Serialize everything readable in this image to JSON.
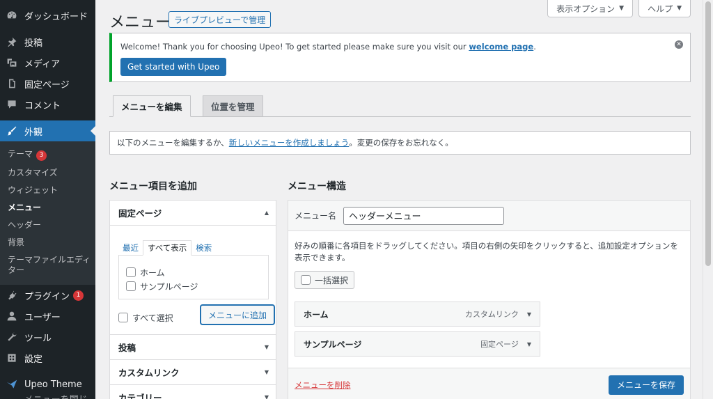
{
  "sidebar": {
    "dashboard": "ダッシュボード",
    "posts": "投稿",
    "media": "メディア",
    "pages": "固定ページ",
    "comments": "コメント",
    "appearance": "外観",
    "submenu": {
      "themes": "テーマ",
      "themes_badge": "3",
      "customize": "カスタマイズ",
      "widgets": "ウィジェット",
      "menus": "メニュー",
      "header": "ヘッダー",
      "background": "背景",
      "theme_editor": "テーマファイルエディター"
    },
    "plugins": "プラグイン",
    "plugins_badge": "1",
    "users": "ユーザー",
    "tools": "ツール",
    "settings": "設定",
    "upeo_theme": "Upeo Theme",
    "collapse": "メニューを閉じる"
  },
  "screen_options": {
    "display_options": "表示オプション",
    "help": "ヘルプ"
  },
  "page": {
    "title": "メニュー",
    "live_preview": "ライブプレビューで管理"
  },
  "notice": {
    "text_before": "Welcome! Thank you for choosing Upeo! To get started please make sure you visit our ",
    "link": "welcome page",
    "text_after": ".",
    "button": "Get started with Upeo"
  },
  "tabs": {
    "edit": "メニューを編集",
    "locations": "位置を管理"
  },
  "manage": {
    "before": "以下のメニューを編集するか、",
    "link": "新しいメニューを作成しましょう",
    "after": "。変更の保存をお忘れなく。"
  },
  "add_items": {
    "heading": "メニュー項目を追加",
    "pages_section": "固定ページ",
    "inner_tabs": {
      "recent": "最近",
      "all": "すべて表示",
      "search": "検索"
    },
    "pages": [
      "ホーム",
      "サンプルページ"
    ],
    "select_all": "すべて選択",
    "add_button": "メニューに追加",
    "sections": [
      "投稿",
      "カスタムリンク",
      "カテゴリー"
    ]
  },
  "structure": {
    "heading": "メニュー構造",
    "name_label": "メニュー名",
    "name_value": "ヘッダーメニュー",
    "instructions": "好みの順番に各項目をドラッグしてください。項目の右側の矢印をクリックすると、追加設定オプションを表示できます。",
    "bulk_select": "一括選択",
    "items": [
      {
        "title": "ホーム",
        "type": "カスタムリンク"
      },
      {
        "title": "サンプルページ",
        "type": "固定ページ"
      }
    ],
    "delete_link": "メニューを削除",
    "save_button": "メニューを保存"
  }
}
